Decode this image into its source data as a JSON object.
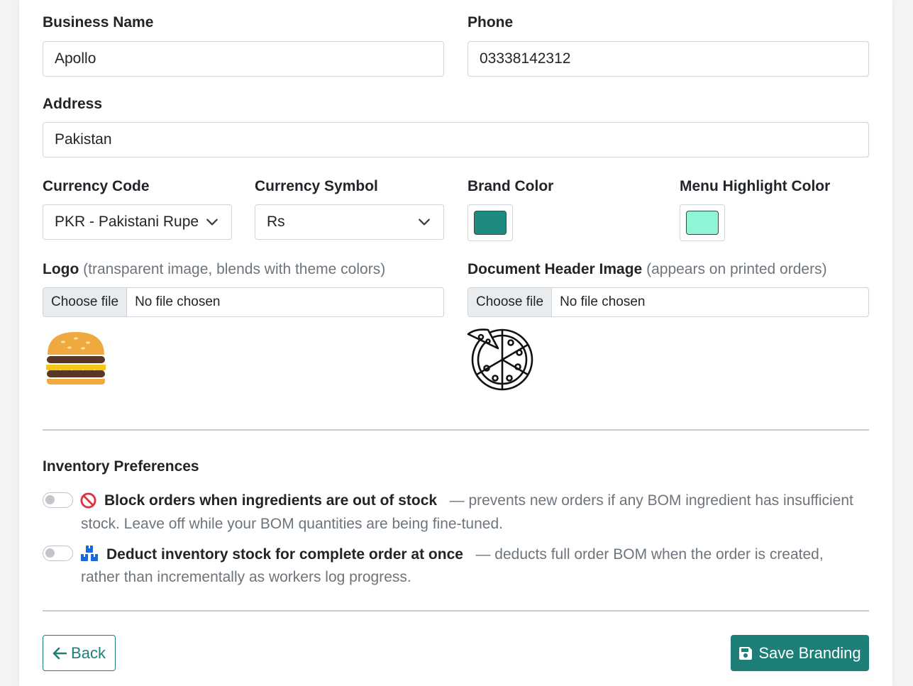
{
  "form": {
    "business_name": {
      "label": "Business Name",
      "value": "Apollo"
    },
    "phone": {
      "label": "Phone",
      "value": "03338142312"
    },
    "address": {
      "label": "Address",
      "value": "Pakistan"
    },
    "currency_code": {
      "label": "Currency Code",
      "value": "PKR - Pakistani Rupee"
    },
    "currency_symbol": {
      "label": "Currency Symbol",
      "value": "Rs"
    },
    "brand_color": {
      "label": "Brand Color",
      "value": "#1f8a80"
    },
    "menu_highlight_color": {
      "label": "Menu Highlight Color",
      "value": "#8ff5d6"
    },
    "logo": {
      "label": "Logo",
      "hint": "(transparent image, blends with theme colors)",
      "choose_label": "Choose file",
      "file_status": "No file chosen",
      "preview_icon": "burger-icon"
    },
    "document_header": {
      "label": "Document Header Image",
      "hint": "(appears on printed orders)",
      "choose_label": "Choose file",
      "file_status": "No file chosen",
      "preview_icon": "pizza-icon"
    }
  },
  "inventory": {
    "title": "Inventory Preferences",
    "prefs": [
      {
        "icon": "prohibited-icon",
        "title": "Block orders when ingredients are out of stock",
        "desc_line1": "— prevents new orders if any BOM ingredient has insufficient",
        "desc_line2": "stock. Leave off while your BOM quantities are being fine-tuned.",
        "enabled": false
      },
      {
        "icon": "boxes-icon",
        "title": "Deduct inventory stock for complete order at once",
        "desc_line1": "— deducts full order BOM when the order is created,",
        "desc_line2": "rather than incrementally as workers log progress.",
        "enabled": false
      }
    ]
  },
  "actions": {
    "back_label": "Back",
    "save_label": "Save Branding"
  },
  "colors": {
    "accent": "#1d7f77",
    "danger": "#dc3545",
    "info": "#1769e0"
  }
}
